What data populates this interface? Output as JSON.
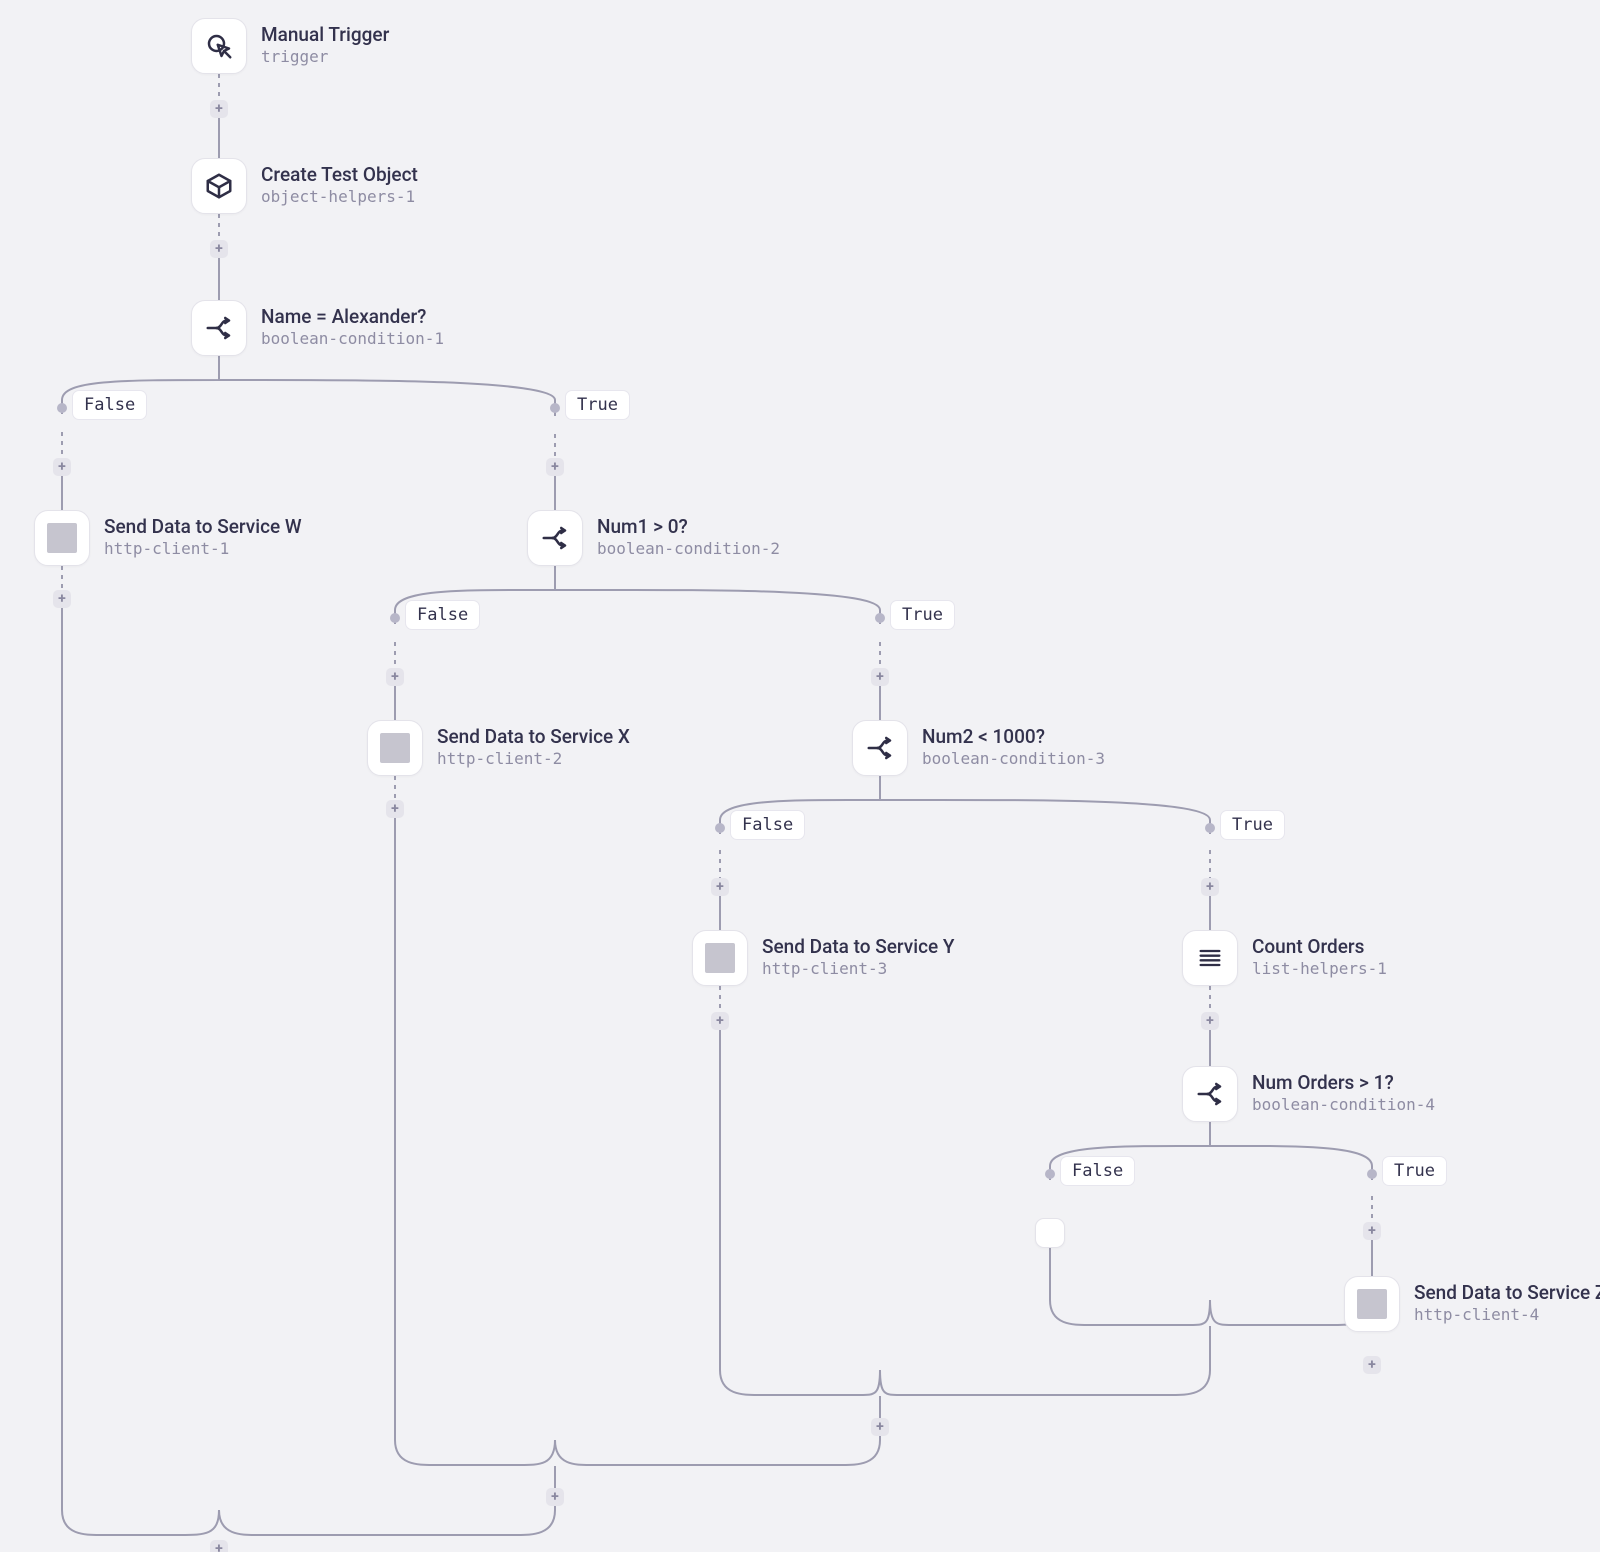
{
  "labels": {
    "true": "True",
    "false": "False"
  },
  "nodes": {
    "trigger": {
      "title": "Manual Trigger",
      "sub": "trigger"
    },
    "obj": {
      "title": "Create Test Object",
      "sub": "object-helpers-1"
    },
    "cond1": {
      "title": "Name = Alexander?",
      "sub": "boolean-condition-1"
    },
    "httpW": {
      "title": "Send Data to Service W",
      "sub": "http-client-1"
    },
    "cond2": {
      "title": "Num1 > 0?",
      "sub": "boolean-condition-2"
    },
    "httpX": {
      "title": "Send Data to Service X",
      "sub": "http-client-2"
    },
    "cond3": {
      "title": "Num2 < 1000?",
      "sub": "boolean-condition-3"
    },
    "httpY": {
      "title": "Send Data to Service Y",
      "sub": "http-client-3"
    },
    "count": {
      "title": "Count Orders",
      "sub": "list-helpers-1"
    },
    "cond4": {
      "title": "Num Orders > 1?",
      "sub": "boolean-condition-4"
    },
    "httpZ": {
      "title": "Send Data to Service Z",
      "sub": "http-client-4"
    },
    "empty": {
      "title": "",
      "sub": ""
    }
  }
}
